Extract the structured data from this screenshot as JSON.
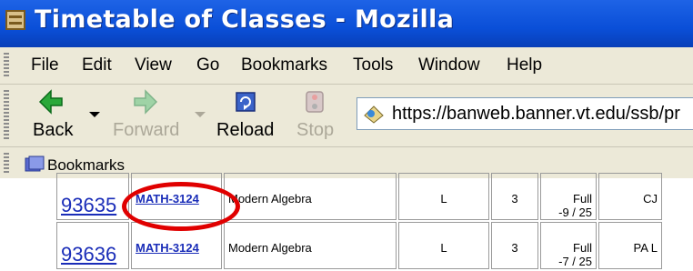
{
  "window": {
    "title": "Timetable of Classes - Mozilla"
  },
  "menu": [
    "File",
    "Edit",
    "View",
    "Go",
    "Bookmarks",
    "Tools",
    "Window",
    "Help"
  ],
  "nav": {
    "back": "Back",
    "forward": "Forward",
    "reload": "Reload",
    "stop": "Stop",
    "url": "https://banweb.banner.vt.edu/ssb/pr"
  },
  "bookmarks_label": "Bookmarks",
  "table": {
    "rows": [
      {
        "crn": "93635",
        "subject": "MATH-3124",
        "title": "Modern Algebra",
        "type": "L",
        "hours": "3",
        "cap": "Full",
        "seats": "-9 / 25",
        "instructor": "CJ"
      },
      {
        "crn": "93636",
        "subject": "MATH-3124",
        "title": "Modern Algebra",
        "type": "L",
        "hours": "3",
        "cap": "Full",
        "seats": "-7 / 25",
        "instructor": "PA L"
      }
    ]
  },
  "colors": {
    "titlebar": "#0a4fd8",
    "link": "#1a2db8",
    "highlight": "#e00000",
    "chrome": "#ece9d8"
  }
}
